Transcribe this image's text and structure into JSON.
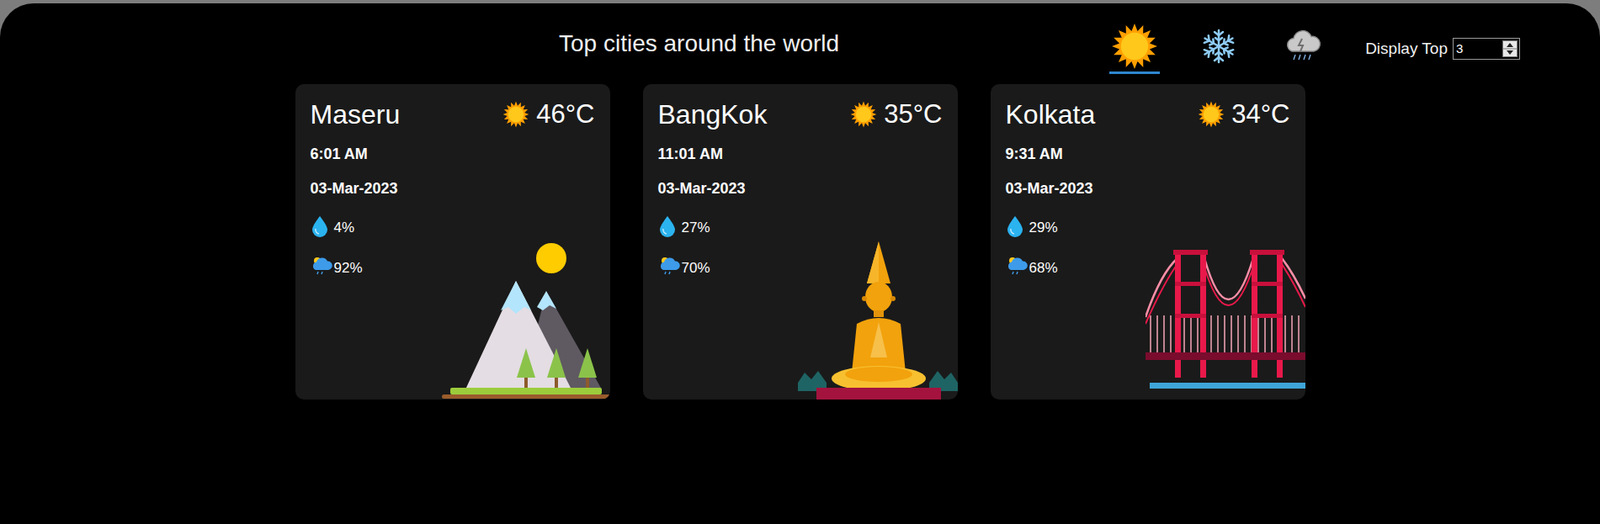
{
  "header": {
    "title": "Top cities around the world"
  },
  "filters": [
    {
      "kind": "sunny",
      "selected": true
    },
    {
      "kind": "snow",
      "selected": false
    },
    {
      "kind": "rain",
      "selected": false
    }
  ],
  "display_top": {
    "label": "Display Top",
    "value": "3"
  },
  "cities": [
    {
      "name": "Maseru",
      "temperature": "46°C",
      "time": "6:01 AM",
      "date": "03-Mar-2023",
      "humidity": "4%",
      "precipitation": "92%",
      "kind": "mountains"
    },
    {
      "name": "BangKok",
      "temperature": "35°C",
      "time": "11:01 AM",
      "date": "03-Mar-2023",
      "humidity": "27%",
      "precipitation": "70%",
      "kind": "buddha"
    },
    {
      "name": "Kolkata",
      "temperature": "34°C",
      "time": "9:31 AM",
      "date": "03-Mar-2023",
      "humidity": "29%",
      "precipitation": "68%",
      "kind": "bridge"
    }
  ]
}
